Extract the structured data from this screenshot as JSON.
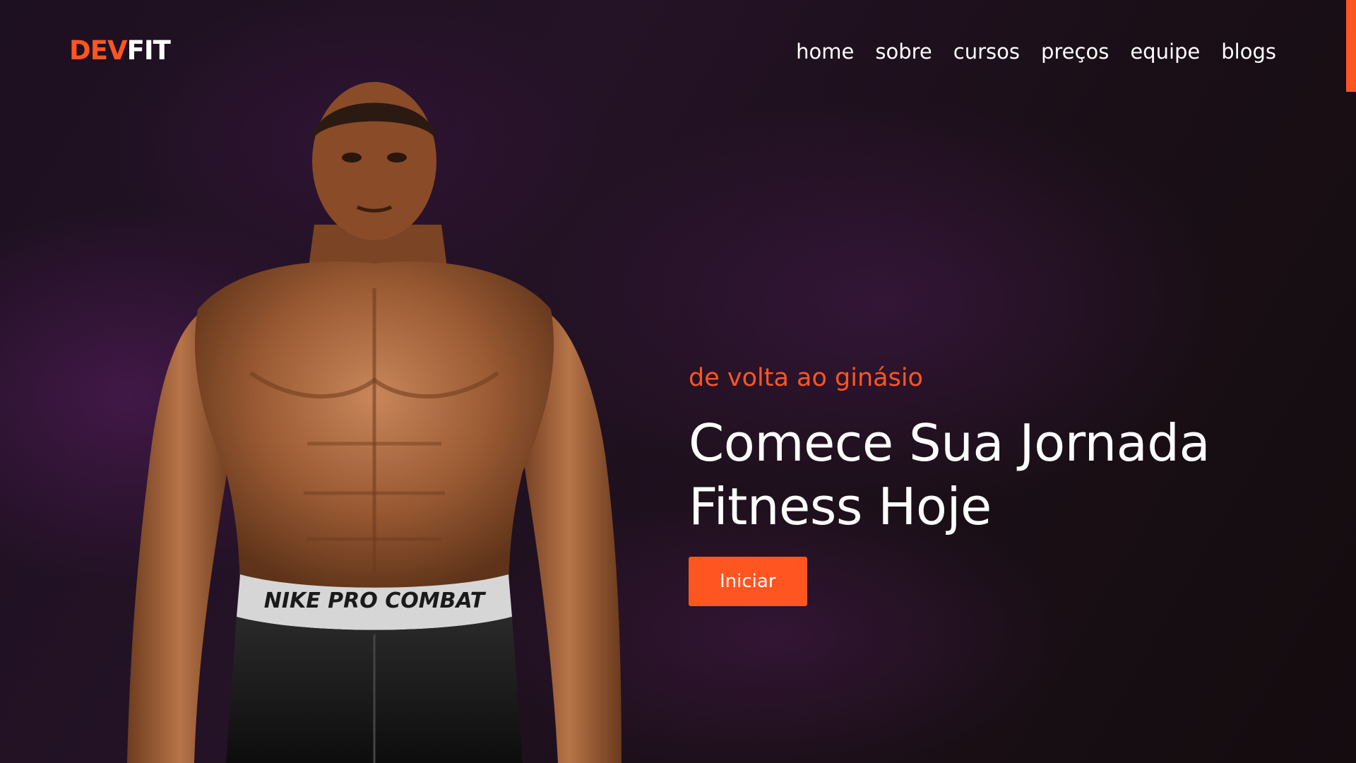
{
  "header": {
    "logo": {
      "accent": "DEV",
      "rest": "FIT"
    },
    "nav": [
      "home",
      "sobre",
      "cursos",
      "preços",
      "equipe",
      "blogs"
    ]
  },
  "hero": {
    "subtitle": "de volta ao ginásio",
    "headline_line1": "Comece Sua Jornada",
    "headline_line2": "Fitness Hoje",
    "cta_label": "Iniciar",
    "image_text": "NIKE PRO COMBAT"
  },
  "colors": {
    "accent": "#ff5521",
    "background": "#1d1020",
    "text": "#ffffff"
  },
  "icons": [
    "scroll-indicator"
  ]
}
